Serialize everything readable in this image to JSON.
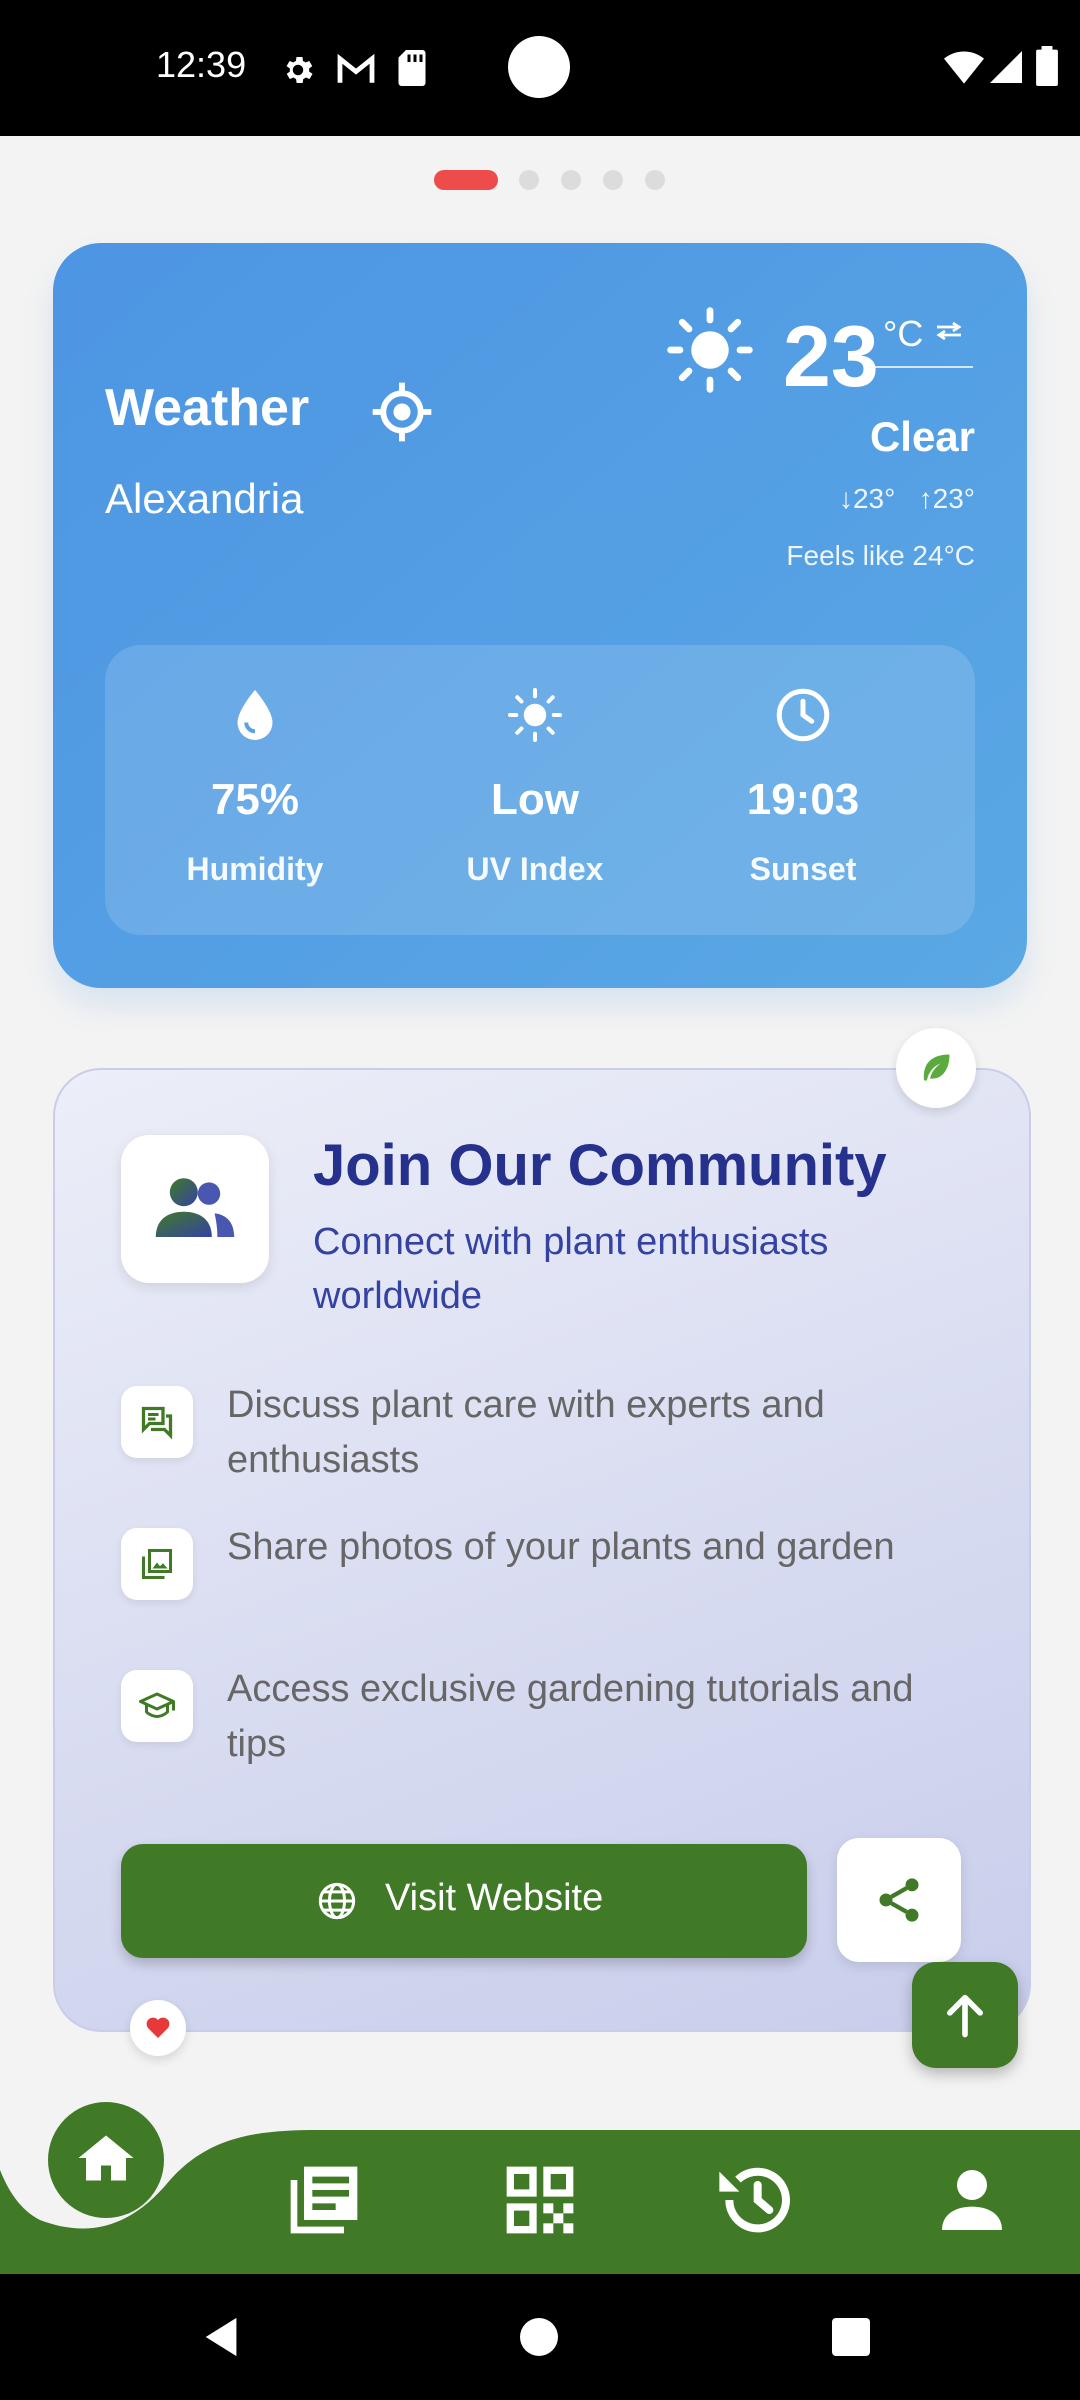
{
  "status_bar": {
    "time": "12:39"
  },
  "weather": {
    "title": "Weather",
    "city": "Alexandria",
    "temperature": "23",
    "unit": "°C",
    "condition": "Clear",
    "low": "↓23°",
    "high": "↑23°",
    "feels_like": "Feels like 24°C",
    "stats": [
      {
        "value": "75%",
        "label": "Humidity",
        "icon": "water-drop-icon"
      },
      {
        "value": "Low",
        "label": "UV Index",
        "icon": "sun-icon"
      },
      {
        "value": "19:03",
        "label": "Sunset",
        "icon": "clock-icon"
      }
    ]
  },
  "community": {
    "title": "Join Our Community",
    "subtitle": "Connect with plant enthusiasts worldwide",
    "features": [
      {
        "text": "Discuss plant care with experts and enthusiasts",
        "icon": "chat-icon"
      },
      {
        "text": "Share photos of your plants and garden",
        "icon": "photos-icon"
      },
      {
        "text": "Access exclusive gardening tutorials and tips",
        "icon": "graduation-cap-icon"
      }
    ],
    "visit_label": "Visit Website"
  },
  "colors": {
    "green": "#417a27",
    "blue": "#4d95e3",
    "indigo": "#25318d",
    "red": "#ee4b4b"
  },
  "page_indicator": {
    "count": 5,
    "active": 0
  }
}
